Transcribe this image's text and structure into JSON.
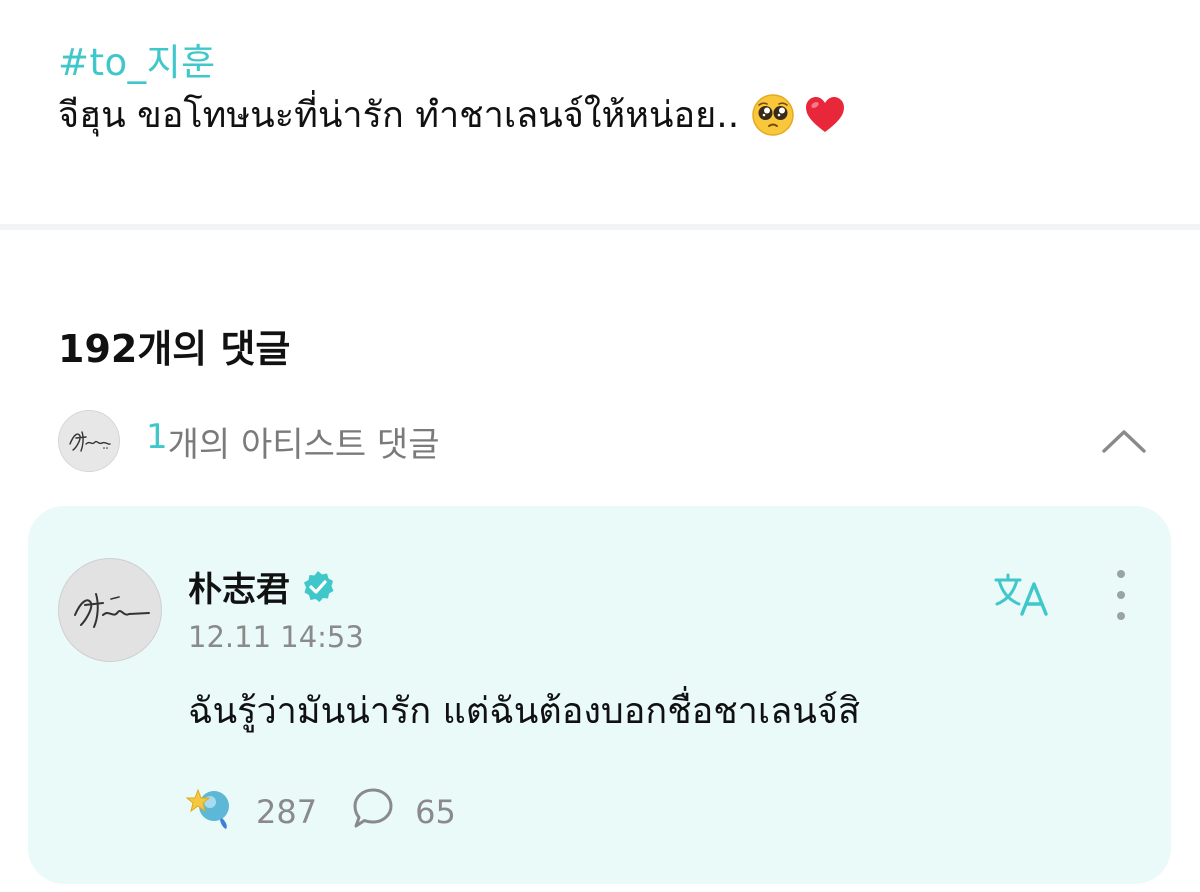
{
  "post": {
    "hashtag": "#to_지훈",
    "body": "จีฮุน ขอโทษนะที่น่ารัก ทำชาเลนจ์ให้หน่อย..",
    "emojis": [
      "pleading-face-emoji",
      "red-heart-emoji"
    ]
  },
  "comments": {
    "count_label": "192개의 댓글",
    "artist_section": {
      "count": "1",
      "label": "개의 아티스트 댓글",
      "collapse_icon": "chevron-up-icon"
    },
    "artist_comment": {
      "author": "朴志君",
      "verified_icon": "verified-badge-icon",
      "timestamp": "12.11 14:53",
      "text": "ฉันรู้ว่ามันน่ารัก แต่ฉันต้องบอกชื่อชาเลนจ์สิ",
      "likes": "287",
      "replies": "65",
      "icons": [
        "translate-icon",
        "more-options-icon",
        "like-reaction-icon",
        "comment-bubble-icon"
      ]
    }
  },
  "colors": {
    "accent": "#3fc7c9",
    "card_bg": "#e9faf8",
    "muted_text": "#8a8a8a"
  }
}
